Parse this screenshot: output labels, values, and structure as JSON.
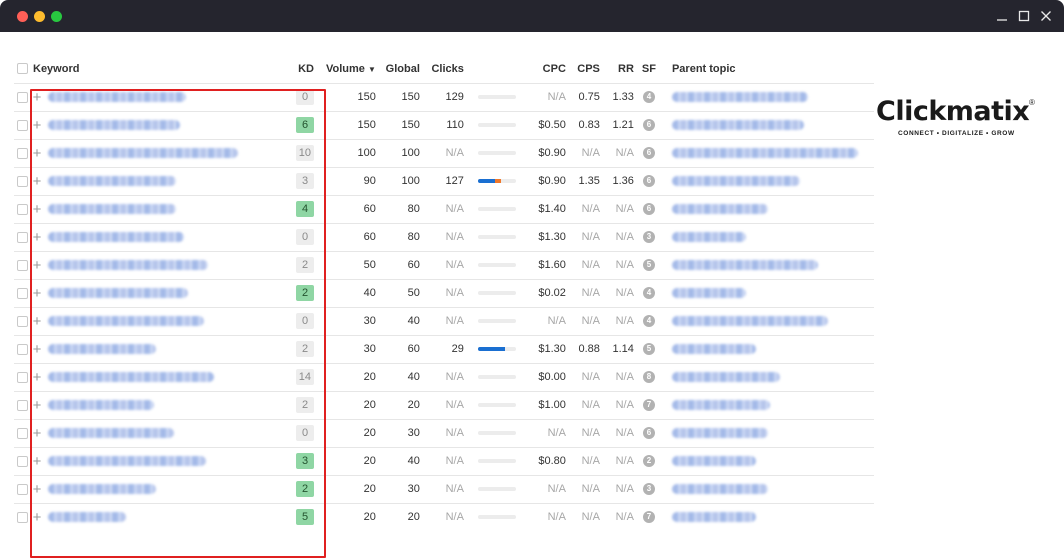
{
  "window": {
    "controls": {
      "minimize_icon": "minimize-icon",
      "maximize_icon": "maximize-icon",
      "close_icon": "close-icon"
    }
  },
  "table": {
    "headers": {
      "keyword": "Keyword",
      "kd": "KD",
      "volume": "Volume",
      "global": "Global",
      "clicks": "Clicks",
      "cpc": "CPC",
      "cps": "CPS",
      "rr": "RR",
      "sf": "SF",
      "parent_topic": "Parent topic"
    },
    "rows": [
      {
        "kd": "0",
        "kd_color": "gray",
        "volume": "150",
        "global": "150",
        "clicks": "129",
        "click_bar": 0,
        "cpc": "N/A",
        "cps": "0.75",
        "rr": "1.33",
        "sf": "4",
        "kw_len": 138,
        "pt_len": 136
      },
      {
        "kd": "6",
        "kd_color": "green",
        "volume": "150",
        "global": "150",
        "clicks": "110",
        "click_bar": 0,
        "cpc": "$0.50",
        "cps": "0.83",
        "rr": "1.21",
        "sf": "6",
        "kw_len": 132,
        "pt_len": 132
      },
      {
        "kd": "10",
        "kd_color": "gray",
        "volume": "100",
        "global": "100",
        "clicks": "N/A",
        "click_bar": 0,
        "cpc": "$0.90",
        "cps": "N/A",
        "rr": "N/A",
        "sf": "6",
        "kw_len": 190,
        "pt_len": 186
      },
      {
        "kd": "3",
        "kd_color": "gray",
        "volume": "90",
        "global": "100",
        "clicks": "127",
        "click_bar": 0.6,
        "cpc": "$0.90",
        "cps": "1.35",
        "rr": "1.36",
        "sf": "6",
        "kw_len": 128,
        "pt_len": 128
      },
      {
        "kd": "4",
        "kd_color": "green",
        "volume": "60",
        "global": "80",
        "clicks": "N/A",
        "click_bar": 0,
        "cpc": "$1.40",
        "cps": "N/A",
        "rr": "N/A",
        "sf": "6",
        "kw_len": 128,
        "pt_len": 96
      },
      {
        "kd": "0",
        "kd_color": "gray",
        "volume": "60",
        "global": "80",
        "clicks": "N/A",
        "click_bar": 0,
        "cpc": "$1.30",
        "cps": "N/A",
        "rr": "N/A",
        "sf": "3",
        "kw_len": 136,
        "pt_len": 74
      },
      {
        "kd": "2",
        "kd_color": "gray",
        "volume": "50",
        "global": "60",
        "clicks": "N/A",
        "click_bar": 0,
        "cpc": "$1.60",
        "cps": "N/A",
        "rr": "N/A",
        "sf": "5",
        "kw_len": 160,
        "pt_len": 146
      },
      {
        "kd": "2",
        "kd_color": "green",
        "volume": "40",
        "global": "50",
        "clicks": "N/A",
        "click_bar": 0,
        "cpc": "$0.02",
        "cps": "N/A",
        "rr": "N/A",
        "sf": "4",
        "kw_len": 140,
        "pt_len": 74
      },
      {
        "kd": "0",
        "kd_color": "gray",
        "volume": "30",
        "global": "40",
        "clicks": "N/A",
        "click_bar": 0,
        "cpc": "N/A",
        "cps": "N/A",
        "rr": "N/A",
        "sf": "4",
        "kw_len": 156,
        "pt_len": 156
      },
      {
        "kd": "2",
        "kd_color": "gray",
        "volume": "30",
        "global": "60",
        "clicks": "29",
        "click_bar": 0.7,
        "cpc": "$1.30",
        "cps": "0.88",
        "rr": "1.14",
        "sf": "5",
        "kw_len": 108,
        "pt_len": 84
      },
      {
        "kd": "14",
        "kd_color": "gray",
        "volume": "20",
        "global": "40",
        "clicks": "N/A",
        "click_bar": 0,
        "cpc": "$0.00",
        "cps": "N/A",
        "rr": "N/A",
        "sf": "8",
        "kw_len": 166,
        "pt_len": 108
      },
      {
        "kd": "2",
        "kd_color": "gray",
        "volume": "20",
        "global": "20",
        "clicks": "N/A",
        "click_bar": 0,
        "cpc": "$1.00",
        "cps": "N/A",
        "rr": "N/A",
        "sf": "7",
        "kw_len": 106,
        "pt_len": 98
      },
      {
        "kd": "0",
        "kd_color": "gray",
        "volume": "20",
        "global": "30",
        "clicks": "N/A",
        "click_bar": 0,
        "cpc": "N/A",
        "cps": "N/A",
        "rr": "N/A",
        "sf": "6",
        "kw_len": 126,
        "pt_len": 96
      },
      {
        "kd": "3",
        "kd_color": "green",
        "volume": "20",
        "global": "40",
        "clicks": "N/A",
        "click_bar": 0,
        "cpc": "$0.80",
        "cps": "N/A",
        "rr": "N/A",
        "sf": "2",
        "kw_len": 158,
        "pt_len": 84
      },
      {
        "kd": "2",
        "kd_color": "green",
        "volume": "20",
        "global": "30",
        "clicks": "N/A",
        "click_bar": 0,
        "cpc": "N/A",
        "cps": "N/A",
        "rr": "N/A",
        "sf": "3",
        "kw_len": 108,
        "pt_len": 96
      },
      {
        "kd": "5",
        "kd_color": "green",
        "volume": "20",
        "global": "20",
        "clicks": "N/A",
        "click_bar": 0,
        "cpc": "N/A",
        "cps": "N/A",
        "rr": "N/A",
        "sf": "7",
        "kw_len": 78,
        "pt_len": 84
      }
    ]
  },
  "logo": {
    "word": "Clickmatix",
    "tagline": "CONNECT • DIGITALIZE • GROW",
    "registered": "®"
  },
  "colors": {
    "titlebar": "#25252e",
    "kd_green": "#8fd6a4",
    "kd_gray": "#ededed",
    "highlight_border": "#e02020",
    "click_bar_blue": "#1a6fd1",
    "click_bar_orange": "#f0782a"
  }
}
